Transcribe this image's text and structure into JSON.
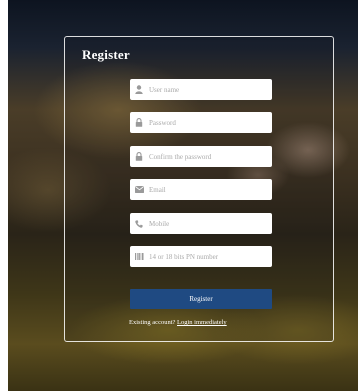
{
  "form": {
    "title": "Register",
    "fields": [
      {
        "icon": "user-icon",
        "placeholder": "User name",
        "value": ""
      },
      {
        "icon": "lock-icon",
        "placeholder": "Password",
        "value": ""
      },
      {
        "icon": "lock-icon",
        "placeholder": "Confirm the password",
        "value": ""
      },
      {
        "icon": "email-icon",
        "placeholder": "Email",
        "value": ""
      },
      {
        "icon": "phone-icon",
        "placeholder": "Mobile",
        "value": ""
      },
      {
        "icon": "barcode-icon",
        "placeholder": "14 or 18 bits PN number",
        "value": ""
      }
    ],
    "submit_label": "Register",
    "footer_text": "Existing account?",
    "footer_link": "Login immediately"
  },
  "colors": {
    "button": "#1f4a82",
    "border": "#ffffff",
    "icon": "#9a9a9a"
  }
}
